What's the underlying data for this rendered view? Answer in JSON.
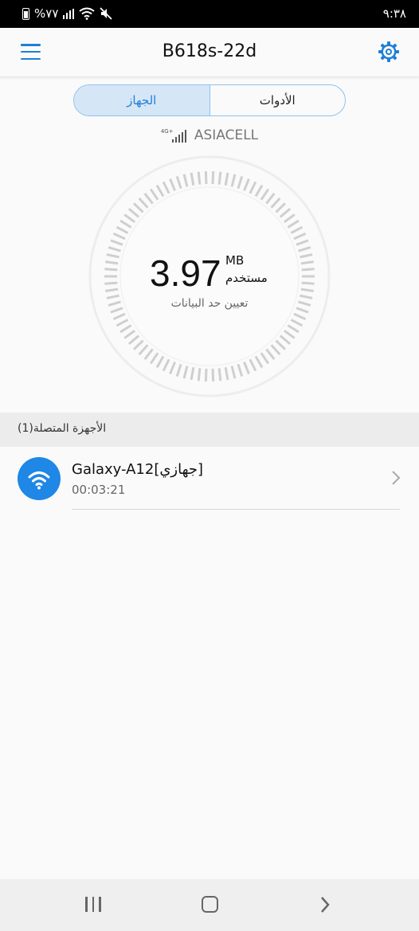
{
  "status_bar": {
    "time": "٩:٣٨",
    "battery": "%٧٧"
  },
  "header": {
    "title": "B618s-22d"
  },
  "tabs": {
    "tools": "الأدوات",
    "device": "الجهاز"
  },
  "operator": {
    "name": "ASIACELL",
    "network": "4G+"
  },
  "usage": {
    "value": "3.97",
    "unit": "MB",
    "used_label": "مستخدم",
    "set_limit_label": "تعيين حد البيانات"
  },
  "devices": {
    "header": "الأجهزة المتصلة(1)",
    "items": [
      {
        "name": "Galaxy-A12[جهازي]",
        "duration": "00:03:21"
      }
    ]
  },
  "colors": {
    "accent": "#1f7fd6",
    "tab_active_bg": "#d5e6f7",
    "wifi_circle": "#1f87e5"
  }
}
